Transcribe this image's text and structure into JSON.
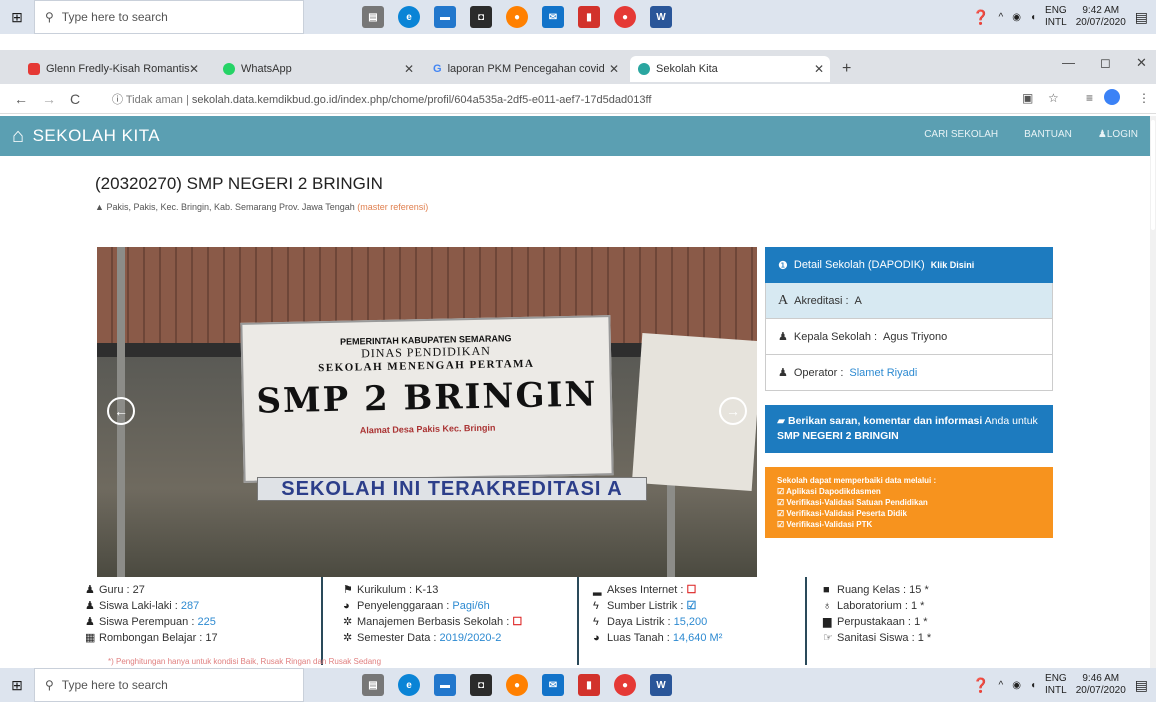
{
  "taskbar": {
    "search_placeholder": "Type here to search",
    "top_time": "9:42 AM",
    "top_date": "20/07/2020",
    "bottom_time": "9:46 AM",
    "bottom_date": "20/07/2020",
    "lang_1": "ENG",
    "lang_2": "INTL"
  },
  "tabs": [
    {
      "label": "Glenn Fredly-Kisah Romantis",
      "favicon_color": "#e53935"
    },
    {
      "label": "WhatsApp",
      "favicon_color": "#25d366"
    },
    {
      "label": "laporan PKM Pencegahan covid",
      "favicon_color": "#4285f4"
    },
    {
      "label": "Sekolah Kita",
      "favicon_color": "#2aa6a0"
    }
  ],
  "address": {
    "security": "Tidak aman",
    "url": "sekolah.data.kemdikbud.go.id/index.php/chome/profil/604a535a-2df5-e011-aef7-17d5dad013ff"
  },
  "site": {
    "brand": "SEKOLAH KITA",
    "nav": [
      "CARI SEKOLAH",
      "BANTUAN",
      "LOGIN"
    ],
    "school_title": "(20320270) SMP NEGERI 2 BRINGIN",
    "address_line": "Pakis, Pakis, Kec. Bringin, Kab. Semarang Prov. Jawa Tengah",
    "master_ref": "(master referensi)",
    "sign": {
      "line1": "PEMERINTAH KABUPATEN SEMARANG",
      "line2": "DINAS PENDIDIKAN",
      "line3": "SEKOLAH MENENGAH PERTAMA",
      "line4": "SMP 2 BRINGIN",
      "line5": "Alamat Desa Pakis Kec. Bringin",
      "banner": "SEKOLAH INI TERAKREDITASI A"
    }
  },
  "panel": {
    "detail": "Detail Sekolah (DAPODIK)",
    "detail_link": "Klik Disini",
    "akreditasi_label": "Akreditasi :",
    "akreditasi_value": "A",
    "kepala_label": "Kepala Sekolah :",
    "kepala_value": "Agus Triyono",
    "operator_label": "Operator :",
    "operator_value": "Slamet Riyadi",
    "saran_1": "Berikan saran, komentar dan informasi",
    "saran_2": "Anda untuk",
    "saran_3": "SMP NEGERI 2 BRINGIN",
    "orange_title": "Sekolah dapat memperbaiki data melalui :",
    "orange_items": [
      "Aplikasi Dapodikdasmen",
      "Verifikasi-Validasi Satuan Pendidikan",
      "Verifikasi-Validasi Peserta Didik",
      "Verifikasi-Validasi PTK"
    ]
  },
  "stats": {
    "col1": [
      {
        "label": "Guru :",
        "value": "27"
      },
      {
        "label": "Siswa Laki-laki :",
        "value": "287"
      },
      {
        "label": "Siswa Perempuan :",
        "value": "225"
      },
      {
        "label": "Rombongan Belajar :",
        "value": "17"
      }
    ],
    "col2": [
      {
        "label": "Kurikulum :",
        "value": "K-13"
      },
      {
        "label": "Penyelenggaraan :",
        "value": "Pagi/6h"
      },
      {
        "label": "Manajemen Berbasis Sekolah :",
        "value": ""
      },
      {
        "label": "Semester Data :",
        "value": "2019/2020-2"
      }
    ],
    "col3": [
      {
        "label": "Akses Internet :",
        "value": ""
      },
      {
        "label": "Sumber Listrik :",
        "value": ""
      },
      {
        "label": "Daya Listrik :",
        "value": "15,200"
      },
      {
        "label": "Luas Tanah :",
        "value": "14,640 M²"
      }
    ],
    "col4": [
      {
        "label": "Ruang Kelas :",
        "value": "15 *"
      },
      {
        "label": "Laboratorium :",
        "value": "1 *"
      },
      {
        "label": "Perpustakaan :",
        "value": "1 *"
      },
      {
        "label": "Sanitasi Siswa :",
        "value": "1 *"
      }
    ],
    "footnote": "*) Penghitungan hanya untuk kondisi Baik, Rusak Ringan dan Rusak Sedang"
  },
  "colors": {
    "navbar": "#5b9fb2",
    "panel_blue": "#1d7bbf",
    "orange": "#f7931e",
    "link": "#2d8ad1"
  }
}
